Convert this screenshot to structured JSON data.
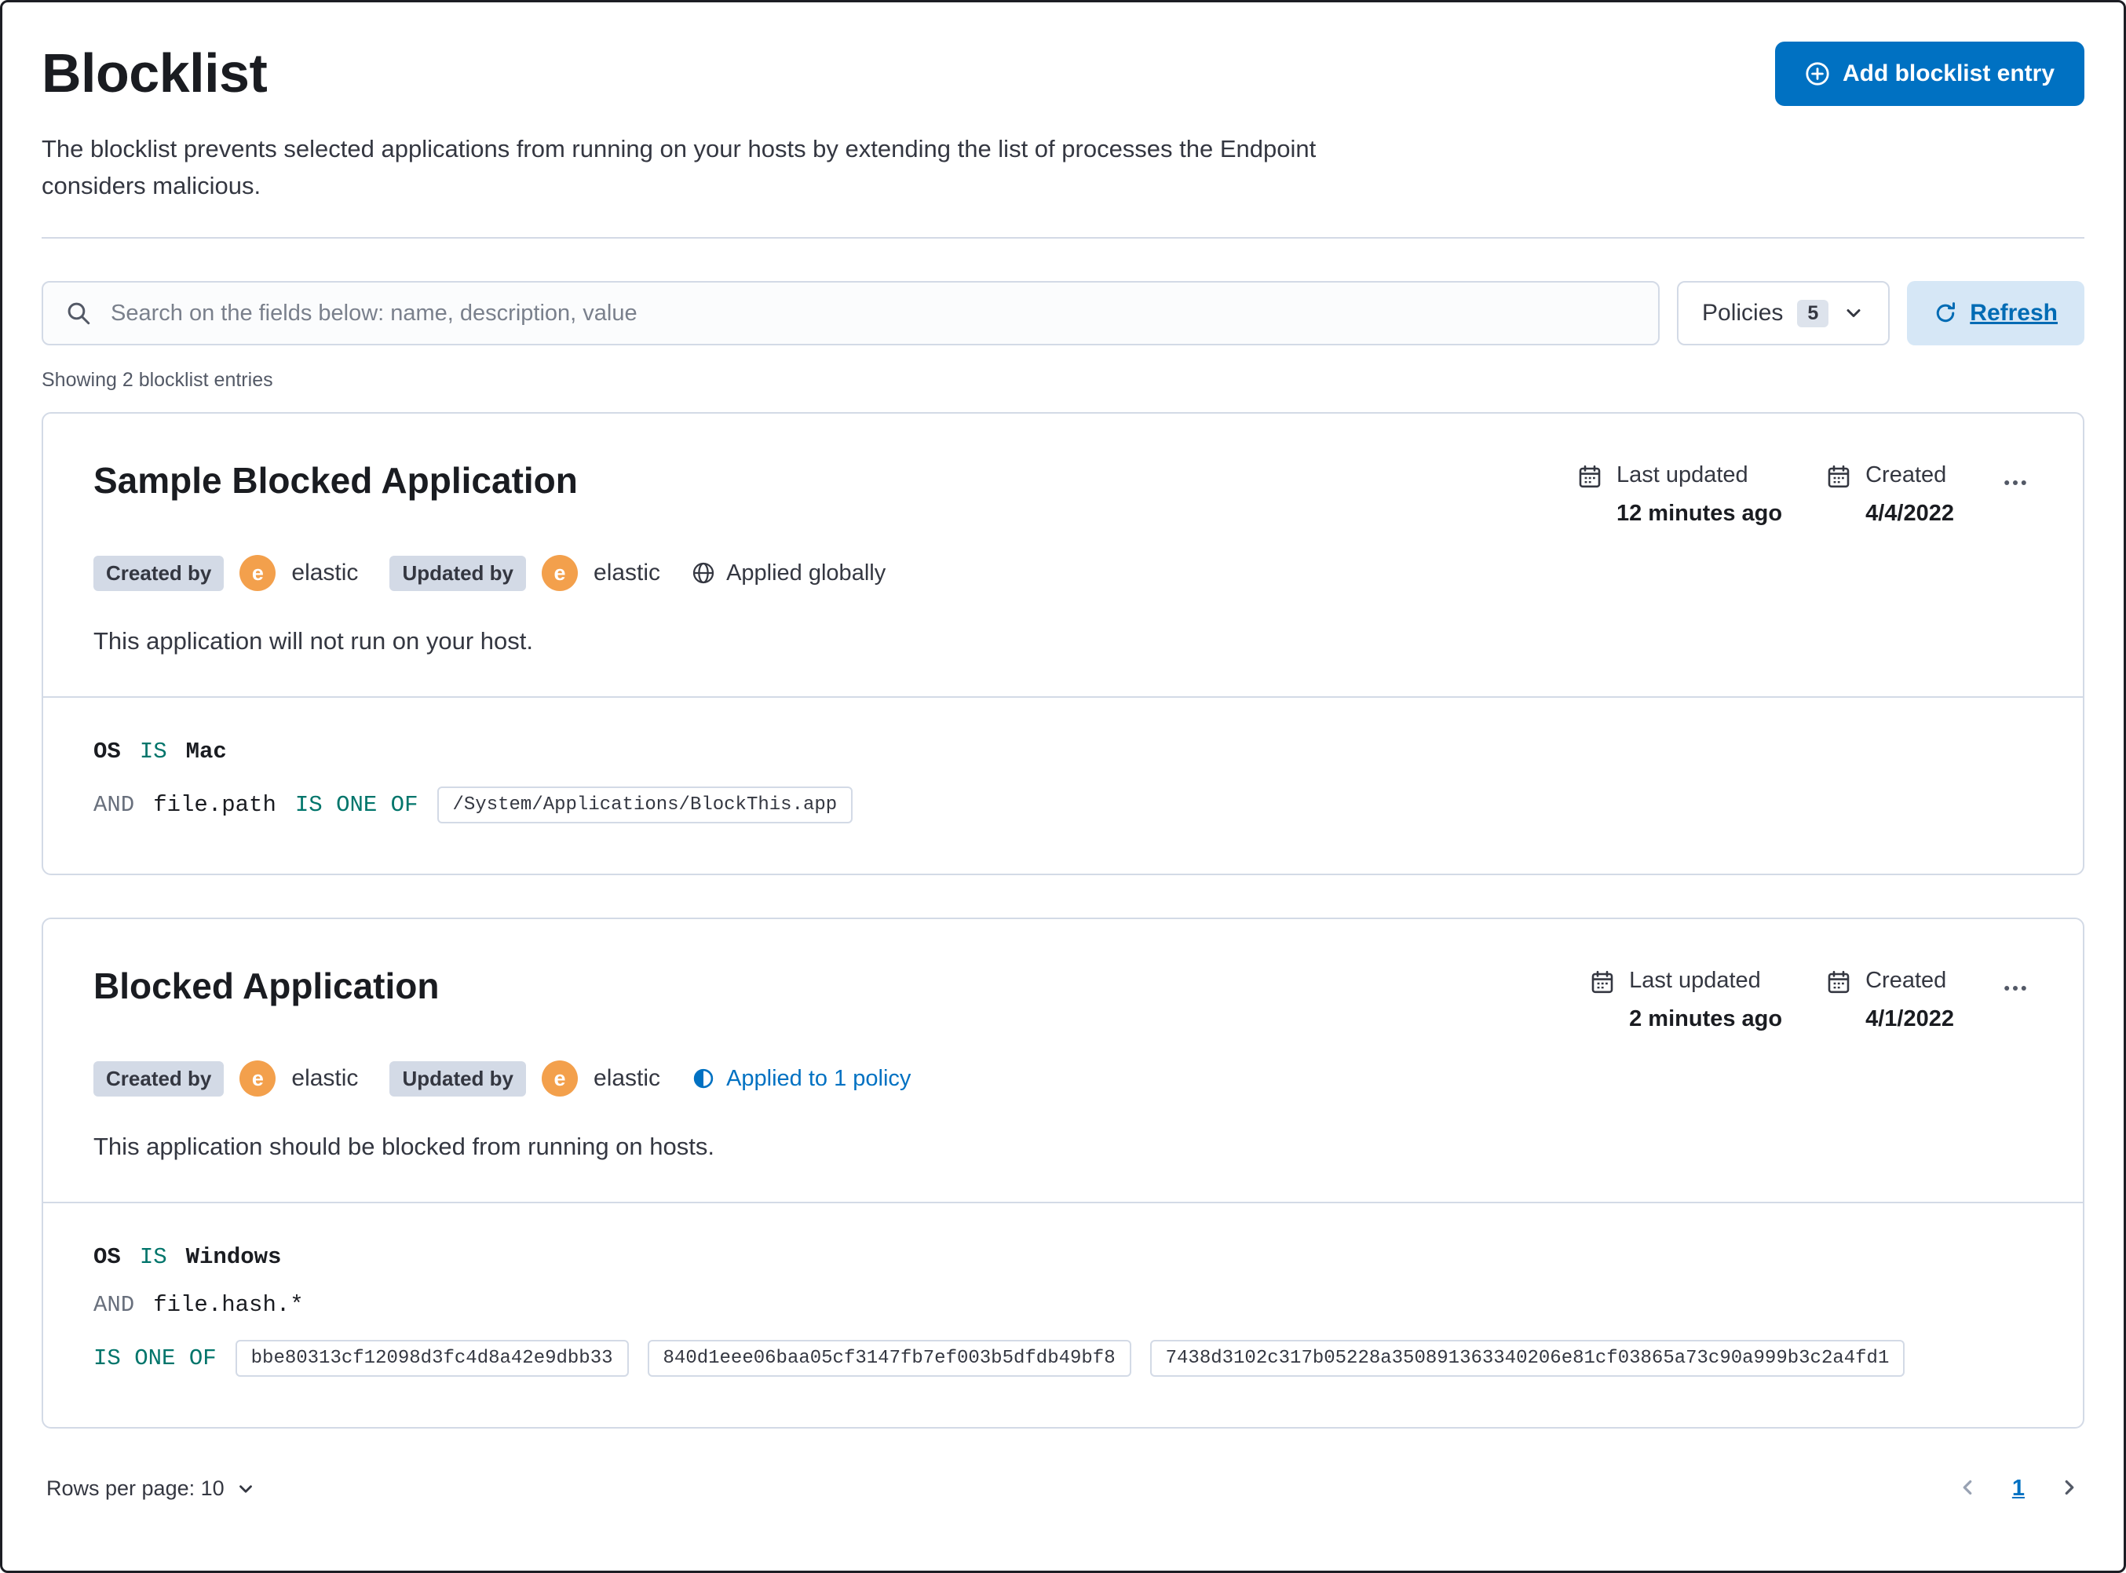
{
  "colors": {
    "primary": "#0071c2",
    "link": "#0071c2",
    "operator": "#00756b",
    "badge_bg": "#d3dae6",
    "avatar_bg": "#f3a04c",
    "refresh_bg": "#d6e7f6",
    "refresh_text": "#006bb4"
  },
  "page": {
    "title": "Blocklist",
    "description": "The blocklist prevents selected applications from running on your hosts by extending the list of processes the Endpoint considers malicious.",
    "add_button_label": "Add blocklist entry",
    "showing_text": "Showing 2 blocklist entries"
  },
  "toolbar": {
    "search_placeholder": "Search on the fields below: name, description, value",
    "policies_label": "Policies",
    "policies_count": "5",
    "refresh_label": "Refresh"
  },
  "entries": [
    {
      "title": "Sample Blocked Application",
      "last_updated_label": "Last updated",
      "last_updated_value": "12 minutes ago",
      "created_label": "Created",
      "created_value": "4/4/2022",
      "created_by_label": "Created by",
      "created_by_user": "elastic",
      "updated_by_label": "Updated by",
      "updated_by_user": "elastic",
      "avatar_initial": "e",
      "scope_label": "Applied globally",
      "description": "This application will not run on your host.",
      "criteria": {
        "os_field": "OS",
        "os_operator": "IS",
        "os_value": "Mac",
        "and_label": "AND",
        "field": "file.path",
        "operator": "IS ONE OF",
        "values": [
          "/System/Applications/BlockThis.app"
        ]
      }
    },
    {
      "title": "Blocked Application",
      "last_updated_label": "Last updated",
      "last_updated_value": "2 minutes ago",
      "created_label": "Created",
      "created_value": "4/1/2022",
      "created_by_label": "Created by",
      "created_by_user": "elastic",
      "updated_by_label": "Updated by",
      "updated_by_user": "elastic",
      "avatar_initial": "e",
      "scope_label": "Applied to 1 policy",
      "description": "This application should be blocked from running on hosts.",
      "criteria": {
        "os_field": "OS",
        "os_operator": "IS",
        "os_value": "Windows",
        "and_label": "AND",
        "field": "file.hash.*",
        "operator": "IS ONE OF",
        "values": [
          "bbe80313cf12098d3fc4d8a42e9dbb33",
          "840d1eee06baa05cf3147fb7ef003b5dfdb49bf8",
          "7438d3102c317b05228a350891363340206e81cf03865a73c90a999b3c2a4fd1"
        ]
      }
    }
  ],
  "footer": {
    "rows_per_page_label": "Rows per page: 10",
    "page_number": "1"
  }
}
